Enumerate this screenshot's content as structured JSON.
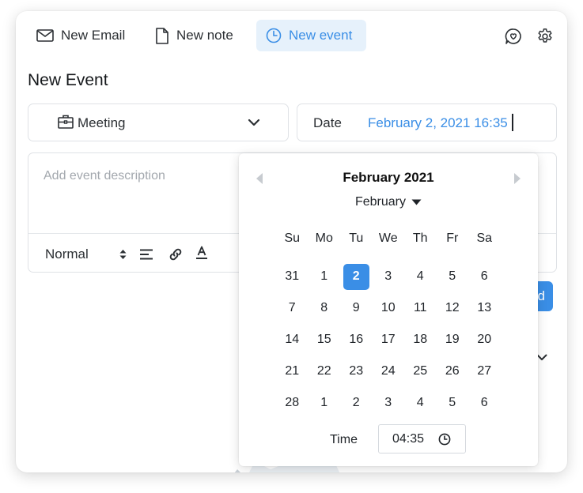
{
  "toolbar": {
    "new_email": "New Email",
    "new_note": "New note",
    "new_event": "New event",
    "icons": [
      "envelope-icon",
      "document-icon",
      "clock-icon",
      "chat-heart-icon",
      "gear-icon"
    ]
  },
  "form": {
    "title": "New Event",
    "event_type": "Meeting",
    "date_label": "Date",
    "date_value": "February 2, 2021 16:35",
    "description_placeholder": "Add event description",
    "text_format": "Normal",
    "add_label": "Add"
  },
  "picker": {
    "month_title": "February 2021",
    "month_select": "February",
    "weekdays": [
      "Su",
      "Mo",
      "Tu",
      "We",
      "Th",
      "Fr",
      "Sa"
    ],
    "weeks": [
      [
        "31",
        "1",
        "2",
        "3",
        "4",
        "5",
        "6"
      ],
      [
        "7",
        "8",
        "9",
        "10",
        "11",
        "12",
        "13"
      ],
      [
        "14",
        "15",
        "16",
        "17",
        "18",
        "19",
        "20"
      ],
      [
        "21",
        "22",
        "23",
        "24",
        "25",
        "26",
        "27"
      ],
      [
        "28",
        "1",
        "2",
        "3",
        "4",
        "5",
        "6"
      ]
    ],
    "selected_day": "2",
    "time_label": "Time",
    "time_value": "04:35"
  },
  "colors": {
    "accent": "#3a8ee6",
    "accent_light": "#e6f1fb",
    "border": "#dfe2e6"
  }
}
